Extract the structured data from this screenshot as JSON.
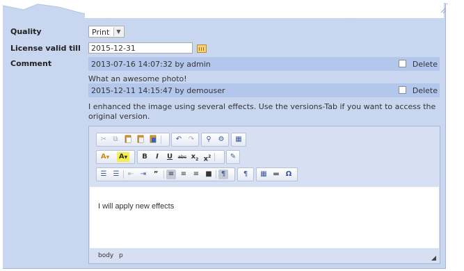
{
  "form": {
    "quality_label": "Quality",
    "quality_value": "Print",
    "license_label": "License valid till",
    "license_value": "2015-12-31",
    "comment_label": "Comment"
  },
  "comments": [
    {
      "meta": "2013-07-16 14:07:32 by admin",
      "delete_label": "Delete",
      "text": "What an awesome photo!"
    },
    {
      "meta": "2015-12-11 14:15:47 by demouser",
      "delete_label": "Delete",
      "text": "I enhanced the image using several effects. Use the versions-Tab if you want to access the original version."
    }
  ],
  "editor": {
    "content": "I will apply new effects",
    "path_body": "body",
    "path_p": "p",
    "toolbar": {
      "bold": "B",
      "italic": "I",
      "underline": "U",
      "strike": "abc",
      "subscript": "x",
      "superscript": "x",
      "quote": "”",
      "omega": "Ω",
      "text_color": "A",
      "bg_color": "A"
    }
  },
  "colors": {
    "panel": "#c9d6ef",
    "comment_header": "#b3c7ec",
    "editor_bg": "#d6e0f2"
  },
  "icons": [
    "cut-icon",
    "copy-icon",
    "paste-icon",
    "paste-text-icon",
    "paste-word-icon",
    "undo-icon",
    "redo-icon",
    "find-icon",
    "replace-icon",
    "select-all-icon",
    "calendar-icon",
    "resize-icon"
  ]
}
